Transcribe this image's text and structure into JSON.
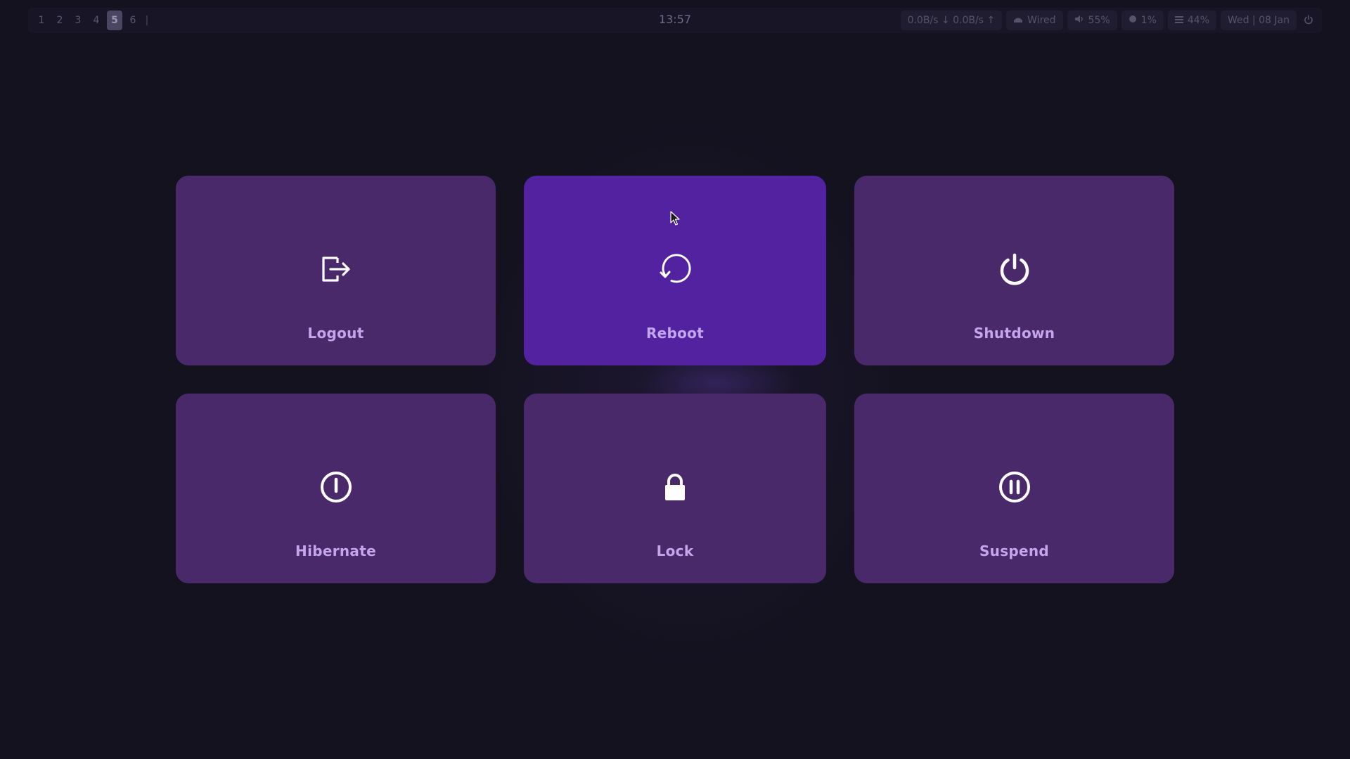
{
  "topbar": {
    "workspaces": [
      "1",
      "2",
      "3",
      "4",
      "5",
      "6"
    ],
    "active_workspace": "5",
    "separator": "|",
    "clock": "13:57",
    "network_speed": "0.0B/s ↓ 0.0B/s ↑",
    "network": {
      "icon": "network-icon",
      "label": "Wired"
    },
    "volume": {
      "icon": "volume-icon",
      "label": "55%"
    },
    "cpu": {
      "icon": "cpu-icon",
      "label": "1%"
    },
    "memory": {
      "icon": "memory-icon",
      "label": "44%"
    },
    "date": "Wed | 08 Jan",
    "power_icon": "power-icon"
  },
  "power_menu": {
    "items": [
      {
        "label": "Logout",
        "icon": "logout-icon"
      },
      {
        "label": "Reboot",
        "icon": "reboot-icon"
      },
      {
        "label": "Shutdown",
        "icon": "shutdown-icon"
      },
      {
        "label": "Hibernate",
        "icon": "hibernate-icon"
      },
      {
        "label": "Lock",
        "icon": "lock-icon"
      },
      {
        "label": "Suspend",
        "icon": "suspend-icon"
      }
    ],
    "hovered": "Reboot"
  },
  "colors": {
    "background": "#14121f",
    "tile": "#4a296b",
    "tile_hover": "#5222a0",
    "label": "#c4a6ec",
    "icon": "#ffffff"
  }
}
